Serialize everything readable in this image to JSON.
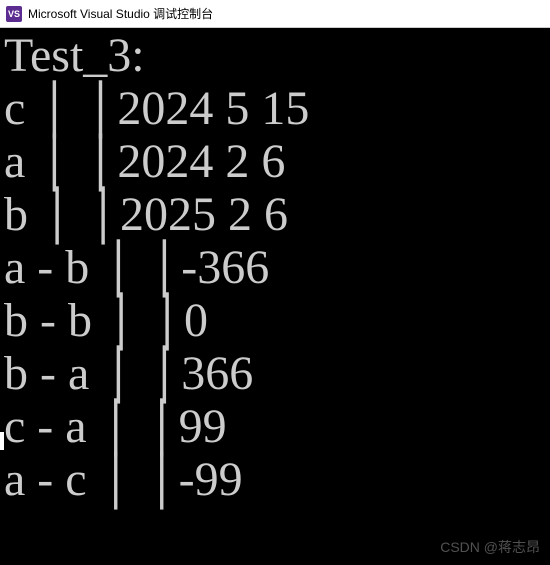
{
  "window": {
    "title": "Microsoft Visual Studio 调试控制台",
    "icon_label": "VS"
  },
  "console": {
    "lines": [
      "Test_3:",
      "c │ │2024 5 15",
      "a │ │2024 2 6",
      "b │ │2025 2 6",
      "a - b │ │-366",
      "b - b │ │0",
      "b - a │ │366",
      "c - a │ │99",
      "a - c │ │-99"
    ]
  },
  "watermark": "CSDN @蒋志昂"
}
